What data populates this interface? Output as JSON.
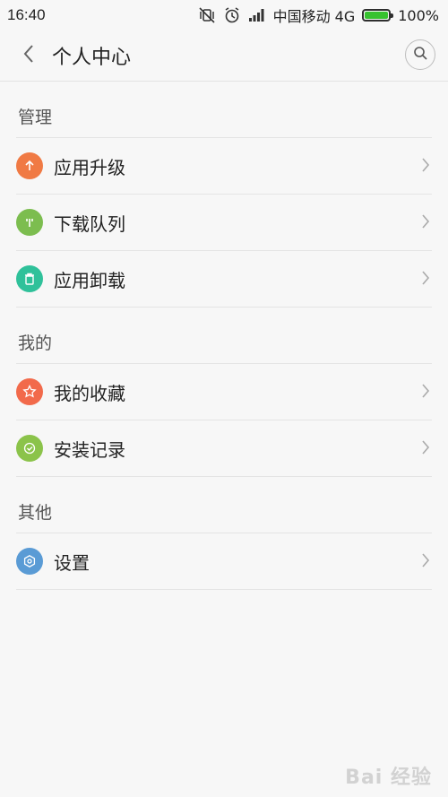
{
  "status": {
    "time": "16:40",
    "carrier": "中国移动 4G",
    "battery": "100%",
    "battery_level": 1.0
  },
  "header": {
    "title": "个人中心"
  },
  "sections": [
    {
      "title": "管理",
      "items": [
        {
          "label": "应用升级",
          "icon": "arrow-up-icon",
          "color": "#f07a44"
        },
        {
          "label": "下载队列",
          "icon": "download-queue-icon",
          "color": "#7cbd4f"
        },
        {
          "label": "应用卸载",
          "icon": "trash-icon",
          "color": "#2fc19a"
        }
      ]
    },
    {
      "title": "我的",
      "items": [
        {
          "label": "我的收藏",
          "icon": "star-icon",
          "color": "#f26a4b"
        },
        {
          "label": "安装记录",
          "icon": "check-circle-icon",
          "color": "#8bc34a"
        }
      ]
    },
    {
      "title": "其他",
      "items": [
        {
          "label": "设置",
          "icon": "gear-icon",
          "color": "#5a9bd5"
        }
      ]
    }
  ],
  "watermark": "Bai 经验"
}
